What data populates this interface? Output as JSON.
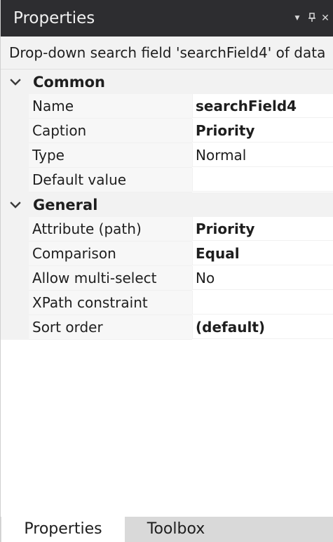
{
  "window": {
    "title": "Properties"
  },
  "description": "Drop-down search field 'searchField4' of data",
  "categories": [
    {
      "label": "Common",
      "rows": [
        {
          "name": "Name",
          "value": "searchField4",
          "bold": true
        },
        {
          "name": "Caption",
          "value": "Priority",
          "bold": true
        },
        {
          "name": "Type",
          "value": "Normal",
          "bold": false
        },
        {
          "name": "Default value",
          "value": "",
          "bold": false
        }
      ]
    },
    {
      "label": "General",
      "rows": [
        {
          "name": "Attribute (path)",
          "value": "Priority",
          "bold": true
        },
        {
          "name": "Comparison",
          "value": "Equal",
          "bold": true
        },
        {
          "name": "Allow multi-select",
          "value": "No",
          "bold": false
        },
        {
          "name": "XPath constraint",
          "value": "",
          "bold": false
        },
        {
          "name": "Sort order",
          "value": "(default)",
          "bold": true
        }
      ]
    }
  ],
  "tabs": [
    {
      "label": "Properties",
      "active": true
    },
    {
      "label": "Toolbox",
      "active": false
    }
  ],
  "icons": {
    "dropdown": "caret-down-icon",
    "pin": "pin-icon",
    "close": "close-icon",
    "collapse": "chevron-down-icon"
  },
  "colors": {
    "titlebar": "#2d2d30",
    "category_bg": "#f2f2f2",
    "tab_strip": "#d9d9d9"
  }
}
